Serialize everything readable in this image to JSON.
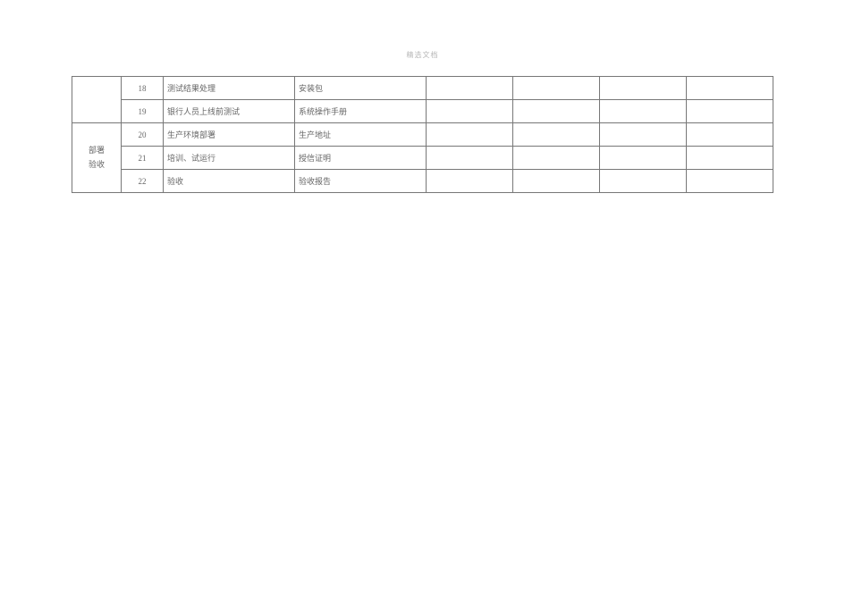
{
  "header": {
    "watermark": "精选文档"
  },
  "table": {
    "category_top": "",
    "category_bottom_line1": "部署",
    "category_bottom_line2": "验收",
    "rows": [
      {
        "num": "18",
        "task": "测试结果处理",
        "deliverable": "安装包",
        "c5": "",
        "c6": "",
        "c7": "",
        "c8": ""
      },
      {
        "num": "19",
        "task": "银行人员上线前测试",
        "deliverable": "系统操作手册",
        "c5": "",
        "c6": "",
        "c7": "",
        "c8": ""
      },
      {
        "num": "20",
        "task": "生产环境部署",
        "deliverable": "生产地址",
        "c5": "",
        "c6": "",
        "c7": "",
        "c8": ""
      },
      {
        "num": "21",
        "task": "培训、试运行",
        "deliverable": "授信证明",
        "c5": "",
        "c6": "",
        "c7": "",
        "c8": ""
      },
      {
        "num": "22",
        "task": "验收",
        "deliverable": "验收报告",
        "c5": "",
        "c6": "",
        "c7": "",
        "c8": ""
      }
    ]
  }
}
